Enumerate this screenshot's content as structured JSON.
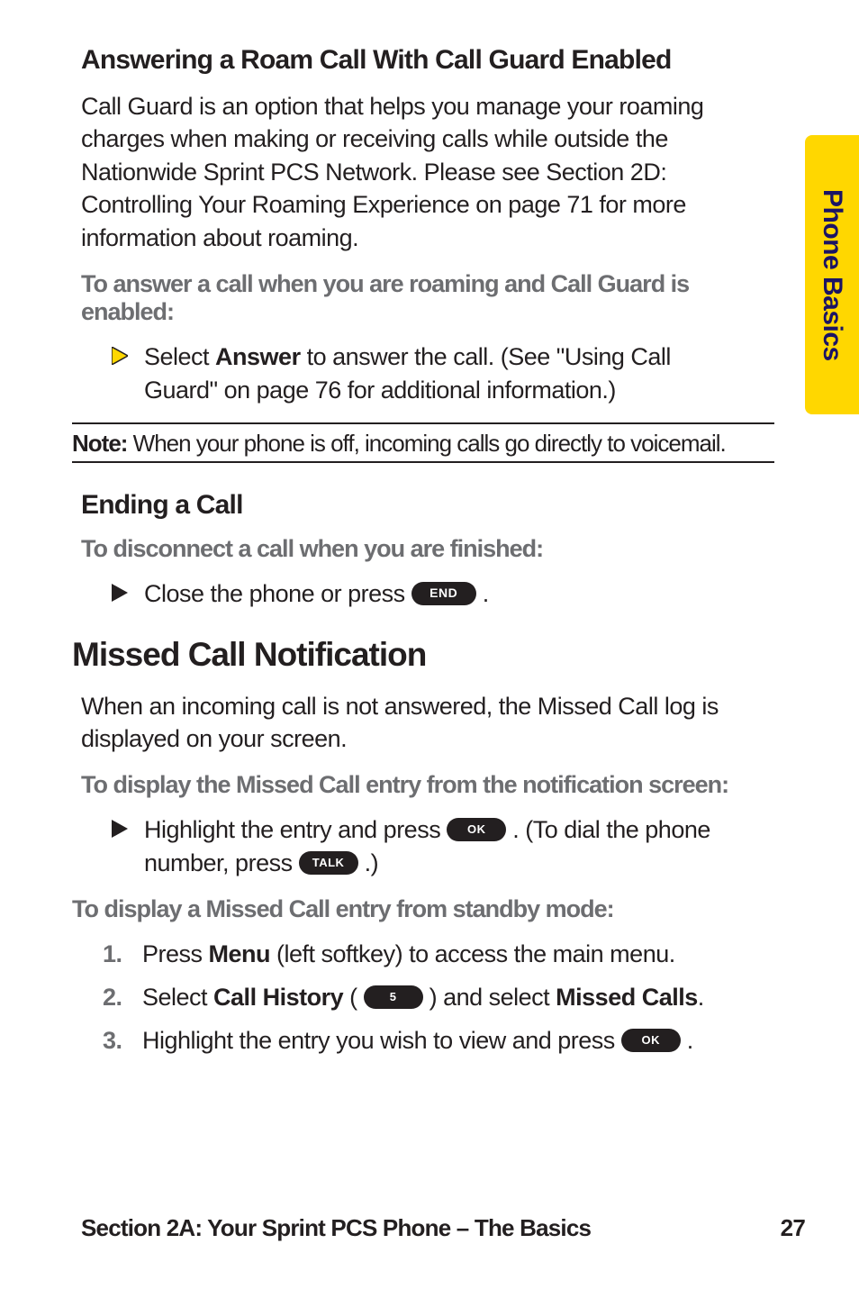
{
  "sideTab": "Phone Basics",
  "s1": {
    "heading": "Answering a Roam Call With Call Guard Enabled",
    "p1": "Call Guard is an option that helps you manage your roaming charges when making or receiving calls while outside the Nationwide Sprint PCS Network. Please see Section 2D: Controlling Your Roaming Experience on page 71 for more information about roaming.",
    "lead1": "To answer a call when you are roaming and Call Guard is enabled:",
    "b1a": "Select ",
    "b1b": "Answer",
    "b1c": " to answer the call. (See \"Using Call Guard\" on page 76 for additional information.)"
  },
  "note": {
    "label": "Note:",
    "text": " When your phone is off, incoming calls go directly to voicemail."
  },
  "s2": {
    "heading": "Ending a Call",
    "lead": "To disconnect a call when you are finished:",
    "b1": "Close the phone or press ",
    "btn": "END",
    "b2": " ."
  },
  "s3": {
    "title": "Missed Call Notification",
    "p1": "When an incoming call is not answered, the Missed Call log is displayed on your screen.",
    "lead1": "To display the Missed Call entry from the notification screen:",
    "b1a": "Highlight the entry and press ",
    "ok": "OK",
    "b1b": " . (To dial the phone number, press ",
    "talk": "TALK",
    "b1c": " .)",
    "lead2": "To display a Missed Call entry from standby mode:",
    "step1a": "Press ",
    "step1b": "Menu",
    "step1c": " (left softkey) to access the main menu.",
    "step2a": "Select ",
    "step2b": "Call History",
    "step2c": " ( ",
    "five": "5",
    "step2d": " ) and select ",
    "step2e": "Missed Calls",
    "step2f": ".",
    "step3a": "Highlight the entry you wish to view and press ",
    "step3b": " ."
  },
  "footer": {
    "left": "Section 2A: Your Sprint PCS Phone – The Basics",
    "right": "27"
  }
}
